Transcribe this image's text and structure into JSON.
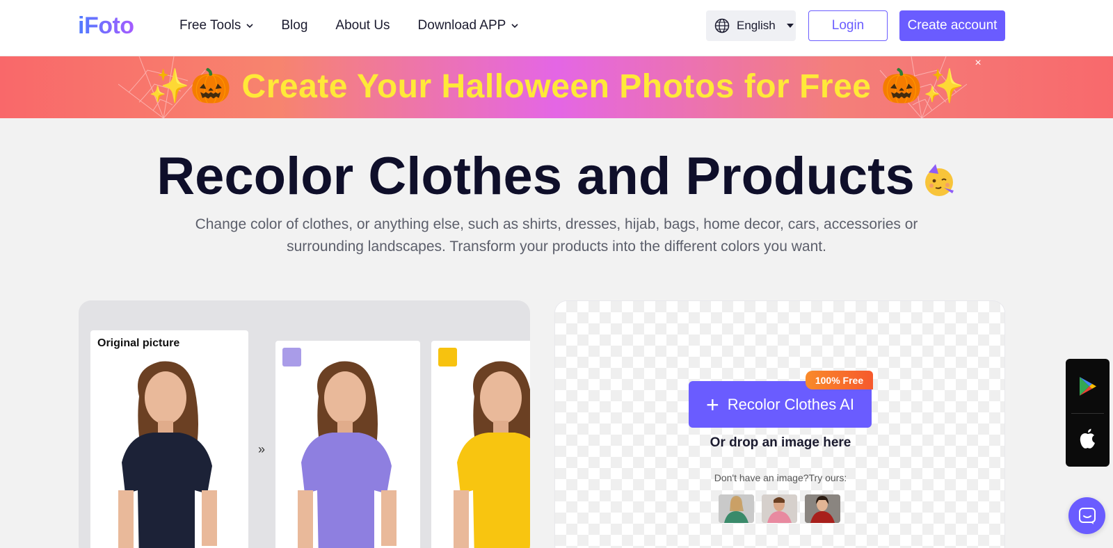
{
  "header": {
    "logo": "iFoto",
    "nav": [
      {
        "label": "Free Tools",
        "has_dropdown": true
      },
      {
        "label": "Blog",
        "has_dropdown": false
      },
      {
        "label": "About Us",
        "has_dropdown": false
      },
      {
        "label": "Download APP",
        "has_dropdown": true
      }
    ],
    "language": "English",
    "login_label": "Login",
    "create_label": "Create account"
  },
  "banner": {
    "text": "✨🎃 Create Your Halloween Photos for Free 🎃✨",
    "close_glyph": "×"
  },
  "hero": {
    "title": "Recolor Clothes and Products",
    "title_emoji": "🥳",
    "subtitle": "Change color of clothes, or anything else, such as shirts, dresses, hijab, bags, home decor, cars, accessories or surrounding landscapes. Transform your products into the different colors you want."
  },
  "showcase": {
    "original_label": "Original picture",
    "arrows": "»",
    "variants": [
      {
        "swatch": "#a99ce8",
        "shirt": "#8e7fe0"
      },
      {
        "swatch": "#f7c20f",
        "shirt": "#f8c510"
      }
    ],
    "original_shirt": "#1c2237"
  },
  "upload": {
    "button_label": "Recolor Clothes AI",
    "badge": "100% Free",
    "drop_text": "Or drop an image here",
    "try_text": "Don't have an image?Try ours:",
    "samples": [
      "sample-woman-green",
      "sample-man-pink",
      "sample-woman-red"
    ]
  },
  "colors": {
    "accent": "#6a5cff",
    "banner_text": "#ffe938",
    "title": "#0f0f2a"
  }
}
